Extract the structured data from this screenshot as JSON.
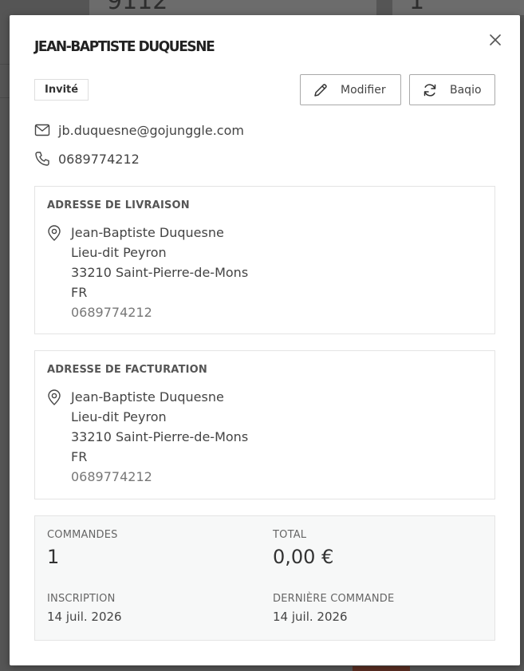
{
  "background": {
    "numbers": [
      "9112",
      "1"
    ]
  },
  "modal": {
    "customer_name": "JEAN-BAPTISTE DUQUESNE",
    "close_icon": "close-icon",
    "badge": "Invité",
    "actions": {
      "edit_label": "Modifier",
      "edit_icon": "pencil-icon",
      "sync_label": "Baqio",
      "sync_icon": "sync-icon"
    },
    "contact": {
      "email": "jb.duquesne@gojunggle.com",
      "phone": "0689774212"
    },
    "shipping": {
      "title": "ADRESSE DE LIVRAISON",
      "lines": [
        "Jean-Baptiste Duquesne",
        "Lieu-dit Peyron",
        "33210 Saint-Pierre-de-Mons",
        "FR",
        "0689774212"
      ]
    },
    "billing": {
      "title": "ADRESSE DE FACTURATION",
      "lines": [
        "Jean-Baptiste Duquesne",
        "Lieu-dit Peyron",
        "33210 Saint-Pierre-de-Mons",
        "FR",
        "0689774212"
      ]
    },
    "stats": {
      "orders_label": "COMMANDES",
      "orders_value": "1",
      "total_label": "TOTAL",
      "total_value": "0,00 €",
      "signup_label": "INSCRIPTION",
      "signup_value": "14 juil. 2026",
      "last_order_label": "DERNIÈRE COMMANDE",
      "last_order_value": "14 juil. 2026"
    }
  },
  "colors": {
    "overlay": "#555555",
    "modal_bg": "#ffffff",
    "border": "#e4e4e4",
    "button_border": "#a9a9a9",
    "stats_bg": "#f7f8f8"
  }
}
